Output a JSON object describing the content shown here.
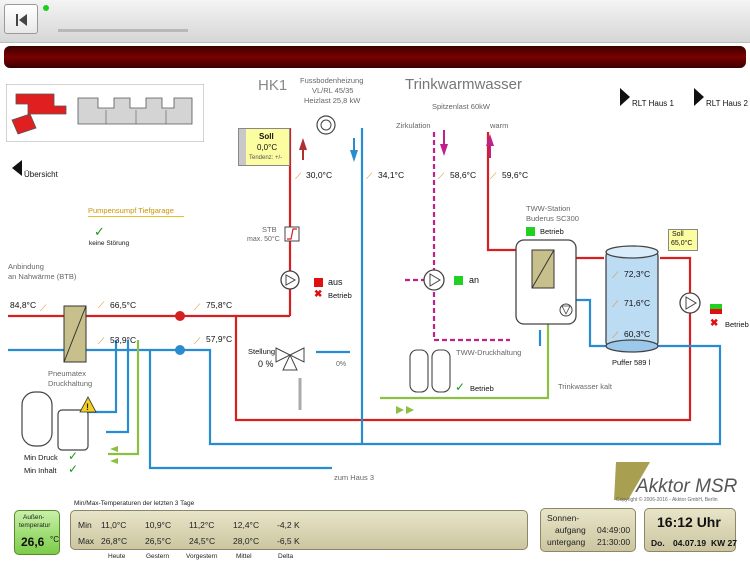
{
  "nav": {
    "back_icon": "skip-back-icon"
  },
  "header": {
    "title_hidden": ""
  },
  "diagram": {
    "hk1_title": "HK1",
    "fbh_line1": "Fussbodenheizung",
    "fbh_line2": "VL/RL 45/35",
    "fbh_line3": "Heizlast 25,8 kW",
    "tww_title": "Trinkwarmwasser",
    "spitzenlast": "Spitzenlast 60kW",
    "zirkulation": "Zirkulation",
    "warm": "warm",
    "rlt1": "RLT Haus 1",
    "rlt2": "RLT Haus 2",
    "uebersicht": "Übersicht",
    "pumpensumpf": "Pumpensumpf Tiefgarage",
    "keine_stoerung": "keine Störung",
    "anbindung1": "Anbindung",
    "anbindung2": "an Nahwärme (BTB)",
    "pneumatex1": "Pneumatex",
    "pneumatex2": "Druckhaltung",
    "min_druck": "Min Druck",
    "min_inhalt": "Min Inhalt",
    "soll_label": "Soll",
    "soll_value": "0,0°C",
    "tendenz": "Tendenz: +/-",
    "stb1": "STB",
    "stb2": "max. 50°C",
    "aus": "aus",
    "betrieb": "Betrieb",
    "stellung": "Stellung",
    "stellung_value": "0 %",
    "zero_pct": "0%",
    "an": "an",
    "tww_station1": "TWW-Station",
    "tww_station2": "Buderus SC300",
    "betrieb2": "Betrieb",
    "soll2_label": "Soll",
    "soll2_value": "65,0°C",
    "tww_druck": "TWW-Druckhaltung",
    "betrieb3": "Betrieb",
    "trinkwasser_kalt": "Trinkwasser kalt",
    "puffer": "Puffer 589 l",
    "zum_haus3": "zum Haus 3",
    "betrieb4": "Betrieb",
    "temps": {
      "t1": "84,8°C",
      "t2": "66,5°C",
      "t3": "53,9°C",
      "t4": "75,8°C",
      "t5": "57,9°C",
      "t6": "30,0°C",
      "t7": "34,1°C",
      "t8": "58,6°C",
      "t9": "59,6°C",
      "t10": "72,3°C",
      "t11": "71,6°C",
      "t12": "60,3°C"
    },
    "logo": "Akktor MSR",
    "copyright": "Copyright © 2006-2016 - Akktor GmbH, Berlin"
  },
  "footer": {
    "outside_label1": "Außen-",
    "outside_label2": "temperatur",
    "outside_value": "26,6",
    "outside_unit": "°C",
    "minmax_title": "Min/Max-Temperaturen der letzten 3 Tage",
    "row_min": "Min",
    "row_max": "Max",
    "min": [
      "11,0°C",
      "10,9°C",
      "11,2°C",
      "12,4°C",
      "-4,2 K"
    ],
    "max": [
      "26,8°C",
      "26,5°C",
      "24,5°C",
      "28,0°C",
      "-6,5 K"
    ],
    "cols": [
      "Heute",
      "Gestern",
      "Vorgestern",
      "Mittel",
      "Delta"
    ],
    "sonnen1": "Sonnen-",
    "aufgang": "aufgang",
    "untergang": "untergang",
    "aufgang_time": "04:49:00",
    "untergang_time": "21:30:00",
    "time": "16:12 Uhr",
    "day": "Do.",
    "date": "04.07.19",
    "kw": "KW 27"
  },
  "colors": {
    "supply": "#d42020",
    "return": "#2a8cd0",
    "tww": "#c0208a",
    "cold": "#8bc040",
    "brand": "#a8a050"
  }
}
